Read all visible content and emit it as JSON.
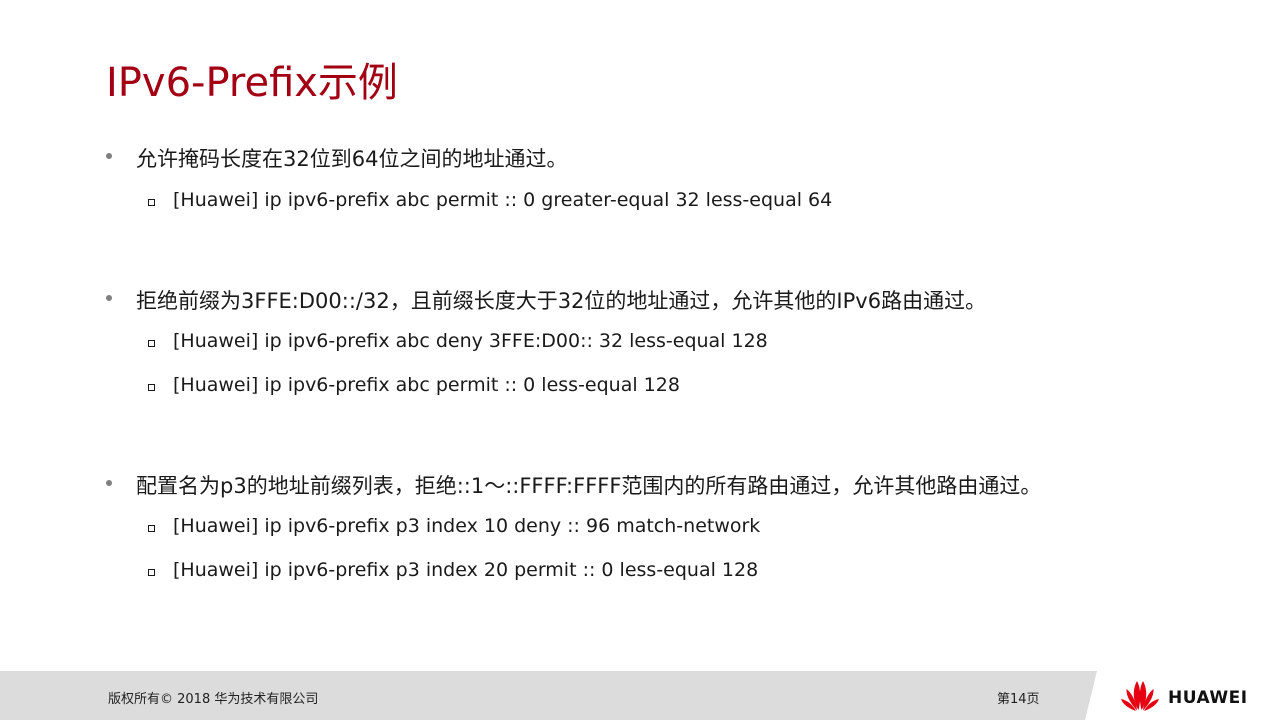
{
  "title": "IPv6-Prefix示例",
  "sections": [
    {
      "bullet": "允许掩码长度在32位到64位之间的地址通过。",
      "commands": [
        "[Huawei] ip ipv6-prefix  abc permit :: 0 greater-equal 32 less-equal 64"
      ]
    },
    {
      "bullet": "拒绝前缀为3FFE:D00::/32，且前缀长度大于32位的地址通过，允许其他的IPv6路由通过。",
      "commands": [
        "[Huawei] ip ipv6-prefix  abc deny 3FFE:D00:: 32 less-equal 128",
        "[Huawei] ip ipv6-prefix  abc permit :: 0 less-equal 128"
      ]
    },
    {
      "bullet": "配置名为p3的地址前缀列表，拒绝::1～::FFFF:FFFF范围内的所有路由通过，允许其他路由通过。",
      "commands": [
        "[Huawei] ip ipv6-prefix  p3 index 10 deny :: 96 match-network",
        "[Huawei] ip ipv6-prefix  p3 index 20 permit :: 0 less-equal 128"
      ]
    }
  ],
  "footer": {
    "copyright": "版权所有© 2018 华为技术有限公司",
    "page": "第14页",
    "logo_text": "HUAWEI"
  },
  "colors": {
    "title": "#a30014",
    "logo": "#e60012",
    "footer_bg": "#dcdcdc"
  },
  "icons": {
    "logo": "huawei-petal-logo"
  }
}
